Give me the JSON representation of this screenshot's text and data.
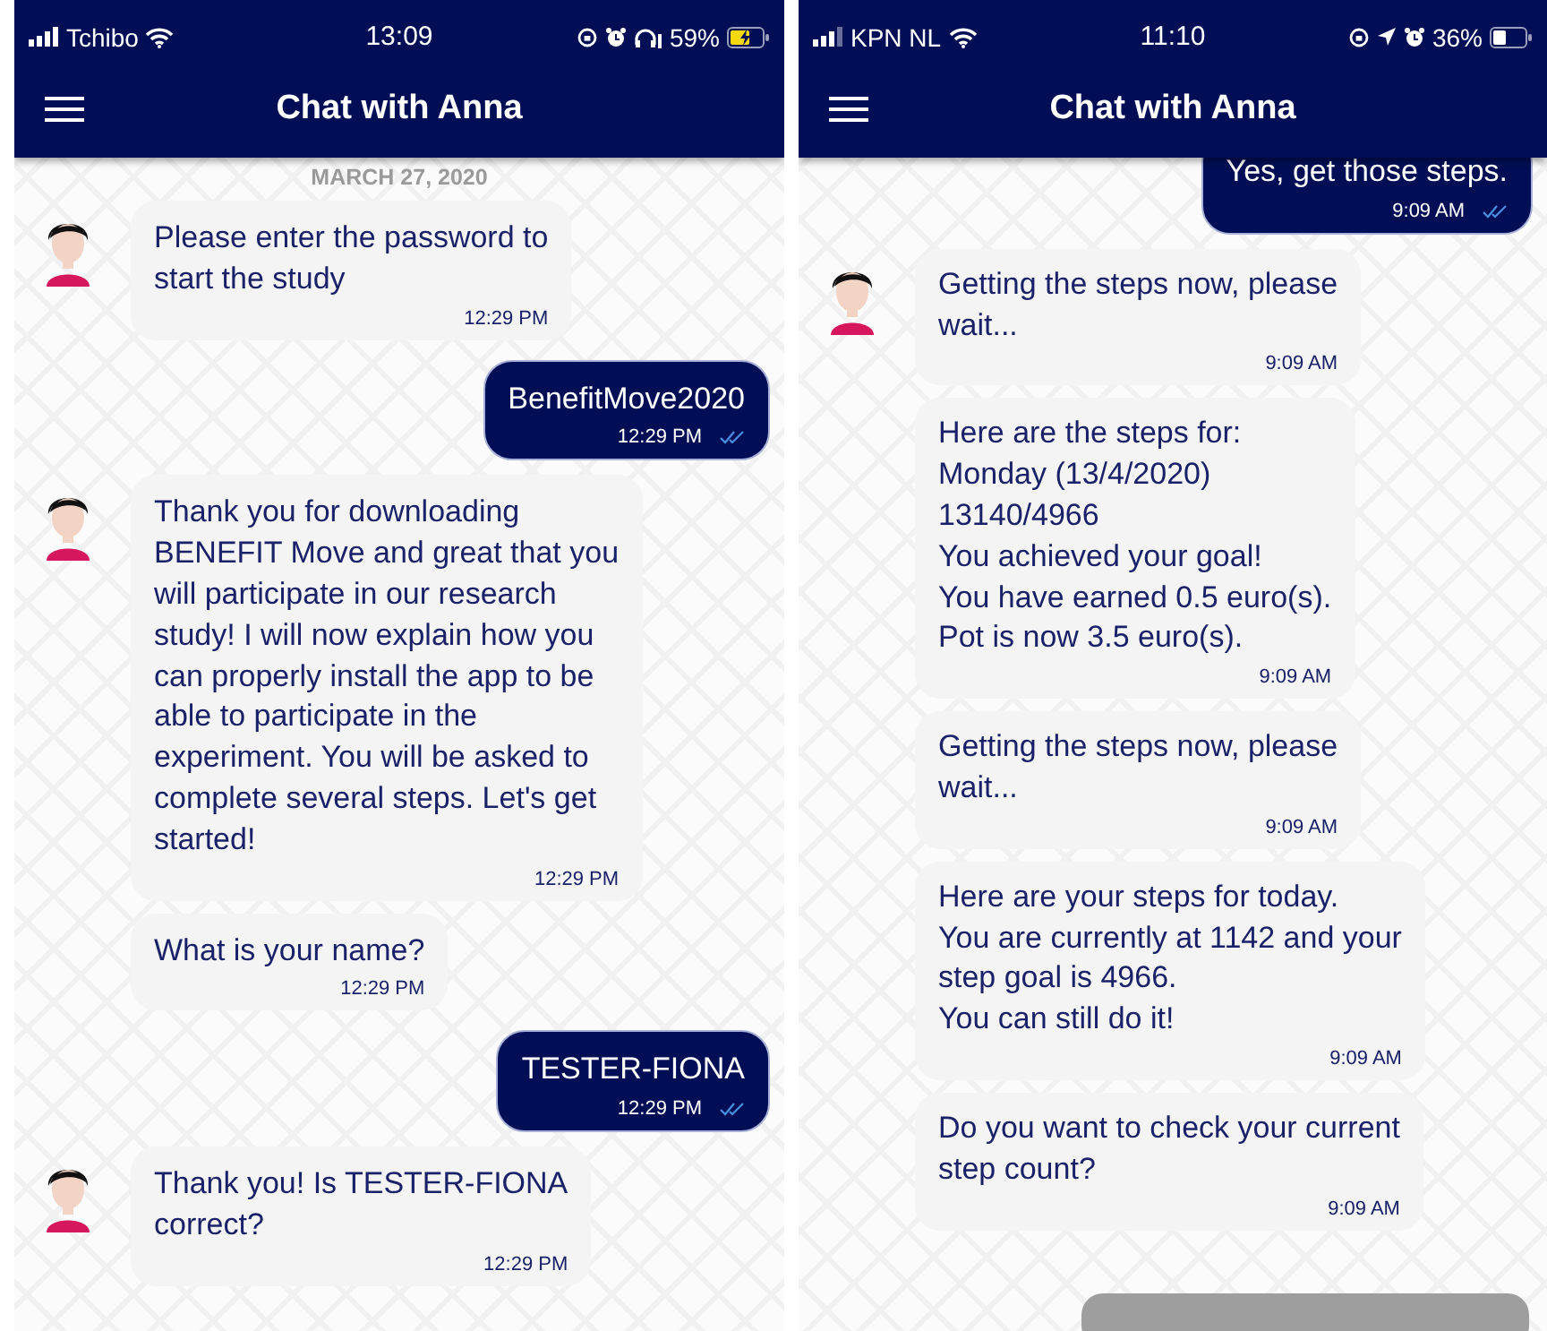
{
  "phones": [
    {
      "status_bar": {
        "carrier": "Tchibo",
        "time": "13:09",
        "icons": [
          {
            "kind": "orientation-lock"
          },
          {
            "kind": "alarm"
          },
          {
            "kind": "headphones"
          }
        ],
        "battery_percent": "59%",
        "charging": true
      },
      "header": {
        "title": "Chat with Anna"
      },
      "date": "MARCH 27, 2020",
      "messages": [
        {
          "kind": "bot",
          "avatar": true,
          "text": "Please enter the password to\nstart the study",
          "time": "12:29 PM"
        },
        {
          "kind": "user",
          "text": "BenefitMove2020",
          "time": "12:29 PM",
          "read": true
        },
        {
          "kind": "bot",
          "avatar": true,
          "text": "Thank you for downloading\nBENEFIT Move and great that you\nwill participate in our research\nstudy! I will now explain how you\ncan properly install the app to be\nable to participate in the\nexperiment. You will be asked to\ncomplete several steps. Let's get\nstarted!",
          "time": "12:29 PM"
        },
        {
          "kind": "bot",
          "avatar": false,
          "text": "What is your name?",
          "time": "12:29 PM"
        },
        {
          "kind": "user",
          "text": "TESTER-FIONA",
          "time": "12:29 PM",
          "read": true
        },
        {
          "kind": "bot",
          "avatar": true,
          "text": "Thank you! Is TESTER-FIONA\ncorrect?",
          "time": "12:29 PM"
        }
      ]
    },
    {
      "status_bar": {
        "carrier": "KPN NL",
        "time": "11:10",
        "icons": [
          {
            "kind": "orientation-lock"
          },
          {
            "kind": "location"
          },
          {
            "kind": "alarm"
          }
        ],
        "battery_percent": "36%",
        "charging": false
      },
      "header": {
        "title": "Chat with Anna"
      },
      "messages": [
        {
          "kind": "user",
          "text": "Yes, get those steps.",
          "time": "9:09 AM",
          "read": true
        },
        {
          "kind": "bot",
          "avatar": true,
          "text": "Getting the steps now, please\nwait...",
          "time": "9:09 AM"
        },
        {
          "kind": "bot",
          "avatar": false,
          "text": "Here are the steps for:\nMonday (13/4/2020)\n13140/4966\nYou achieved your goal!\nYou have earned 0.5 euro(s).\nPot is now 3.5 euro(s).",
          "time": "9:09 AM"
        },
        {
          "kind": "bot",
          "avatar": false,
          "text": "Getting the steps now, please\nwait...",
          "time": "9:09 AM"
        },
        {
          "kind": "bot",
          "avatar": false,
          "text": "Here are your steps for today.\nYou are currently at 1142 and your\nstep goal is 4966.\nYou can still do it!",
          "time": "9:09 AM"
        },
        {
          "kind": "bot",
          "avatar": false,
          "text": "Do you want to check your current\nstep count?",
          "time": "9:09 AM"
        }
      ],
      "input_bar": true
    }
  ]
}
